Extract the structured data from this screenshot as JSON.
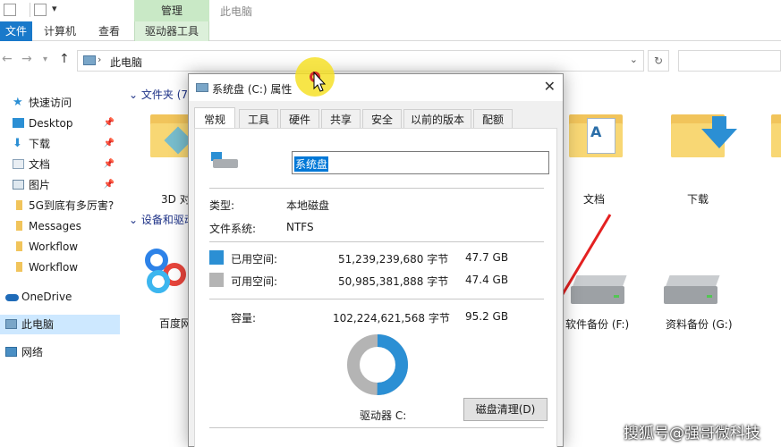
{
  "window": {
    "title": "此电脑",
    "context_tab_group": "管理"
  },
  "ribbon": {
    "tabs": [
      "文件",
      "计算机",
      "查看",
      "驱动器工具"
    ]
  },
  "address": {
    "path": "此电脑"
  },
  "nav_pane": {
    "items": [
      {
        "label": "快速访问",
        "icon": "star-icon",
        "pinned": false
      },
      {
        "label": "Desktop",
        "icon": "desktop-icon",
        "pinned": true
      },
      {
        "label": "下载",
        "icon": "download-icon",
        "pinned": true
      },
      {
        "label": "文档",
        "icon": "document-icon",
        "pinned": true
      },
      {
        "label": "图片",
        "icon": "picture-icon",
        "pinned": true
      },
      {
        "label": "5G到底有多厉害?",
        "icon": "folder-icon",
        "pinned": false
      },
      {
        "label": "Messages",
        "icon": "folder-icon",
        "pinned": false
      },
      {
        "label": "Workflow",
        "icon": "folder-icon",
        "pinned": false
      },
      {
        "label": "Workflow",
        "icon": "folder-icon",
        "pinned": false
      },
      {
        "label": "OneDrive",
        "icon": "cloud-icon",
        "pinned": false
      },
      {
        "label": "此电脑",
        "icon": "computer-icon",
        "pinned": false,
        "selected": true
      },
      {
        "label": "网络",
        "icon": "network-icon",
        "pinned": false
      }
    ]
  },
  "content": {
    "folders_header": "文件夹 (7)",
    "devices_header": "设备和驱动器",
    "folders": [
      {
        "label": "3D 对",
        "icon": "3d-objects-folder-icon"
      },
      {
        "label": "文档",
        "icon": "documents-folder-icon"
      },
      {
        "label": "下载",
        "icon": "downloads-folder-icon"
      }
    ],
    "devices": [
      {
        "label": "百度网",
        "icon": "baidu-netdisk-icon"
      },
      {
        "label": "软件备份 (F:)",
        "icon": "drive-icon"
      },
      {
        "label": "资料备份 (G:)",
        "icon": "drive-icon"
      }
    ]
  },
  "dialog": {
    "title": "系统盘 (C:) 属性",
    "tabs": [
      "常规",
      "工具",
      "硬件",
      "共享",
      "安全",
      "以前的版本",
      "配额"
    ],
    "active_tab": "常规",
    "volume_name": "系统盘",
    "type_label": "类型:",
    "type_value": "本地磁盘",
    "fs_label": "文件系统:",
    "fs_value": "NTFS",
    "used_label": "已用空间:",
    "used_bytes": "51,239,239,680 字节",
    "used_gb": "47.7 GB",
    "free_label": "可用空间:",
    "free_bytes": "50,985,381,888 字节",
    "free_gb": "47.4 GB",
    "capacity_label": "容量:",
    "capacity_bytes": "102,224,621,568 字节",
    "capacity_gb": "95.2 GB",
    "drive_label": "驱动器 C:",
    "cleanup_button": "磁盘清理(D)",
    "used_fraction": 0.501,
    "used_color": "#2b8fd4",
    "free_color": "#b4b4b4"
  },
  "watermark": "搜狐号@强哥微科技"
}
